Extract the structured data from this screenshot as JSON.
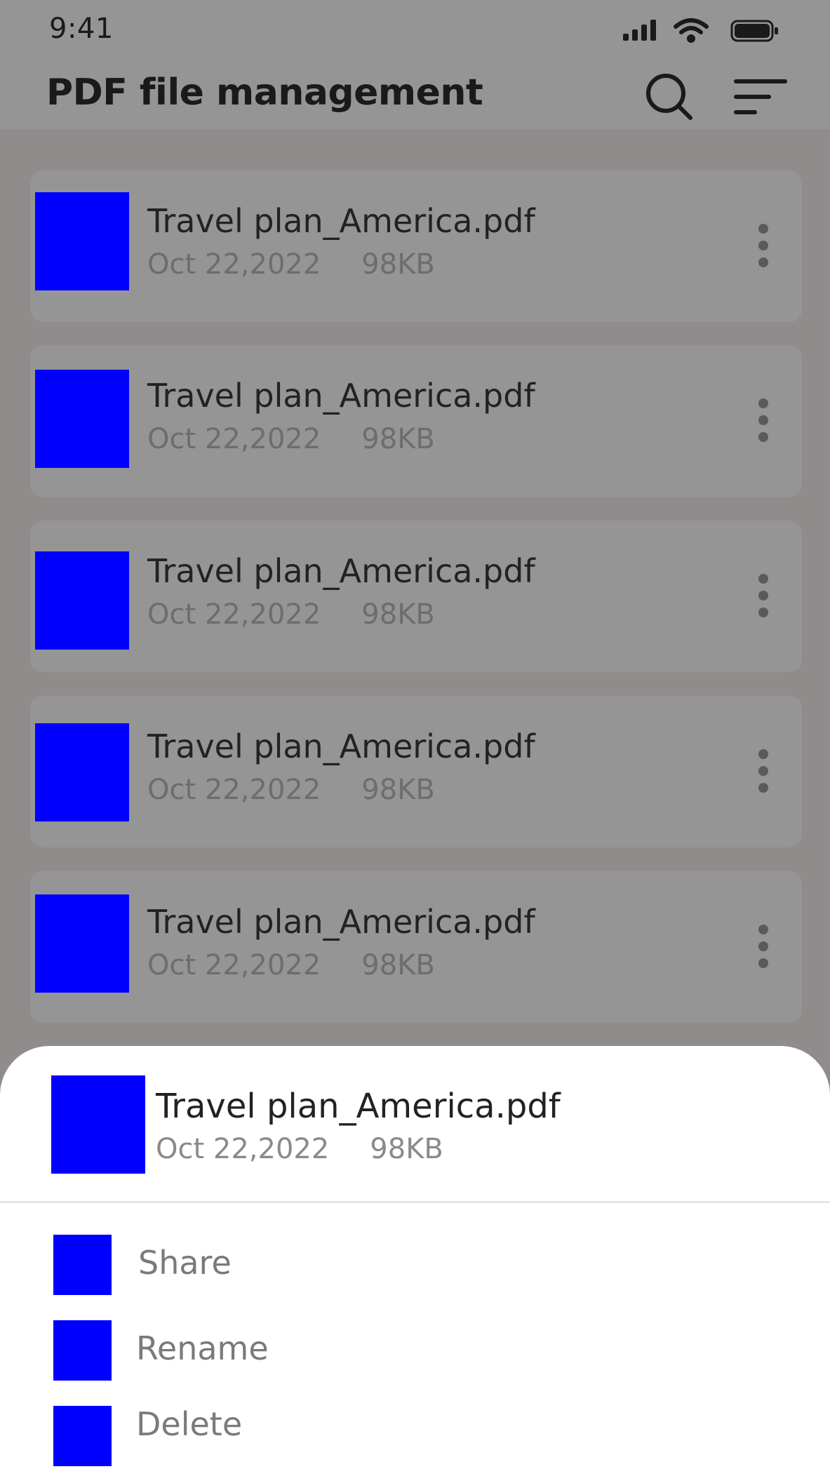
{
  "status_bar": {
    "time": "9:41",
    "icons": [
      "signal-icon",
      "wifi-icon",
      "battery-icon"
    ]
  },
  "header": {
    "title": "PDF file management",
    "actions": [
      "search-icon",
      "sort-icon"
    ]
  },
  "files": [
    {
      "name": "Travel plan_America.pdf",
      "date": "Oct 22,2022",
      "size": "98KB"
    },
    {
      "name": "Travel plan_America.pdf",
      "date": "Oct 22,2022",
      "size": "98KB"
    },
    {
      "name": "Travel plan_America.pdf",
      "date": "Oct 22,2022",
      "size": "98KB"
    },
    {
      "name": "Travel plan_America.pdf",
      "date": "Oct 22,2022",
      "size": "98KB"
    },
    {
      "name": "Travel plan_America.pdf",
      "date": "Oct 22,2022",
      "size": "98KB"
    }
  ],
  "sheet": {
    "file": {
      "name": "Travel plan_America.pdf",
      "date": "Oct 22,2022",
      "size": "98KB"
    },
    "actions": [
      {
        "label": "Share"
      },
      {
        "label": "Rename"
      },
      {
        "label": "Delete"
      }
    ]
  },
  "colors": {
    "overlay": "#959595",
    "list_background": "#918c8c",
    "thumbnail": "#0000ff",
    "sheet_background": "#ffffff"
  }
}
